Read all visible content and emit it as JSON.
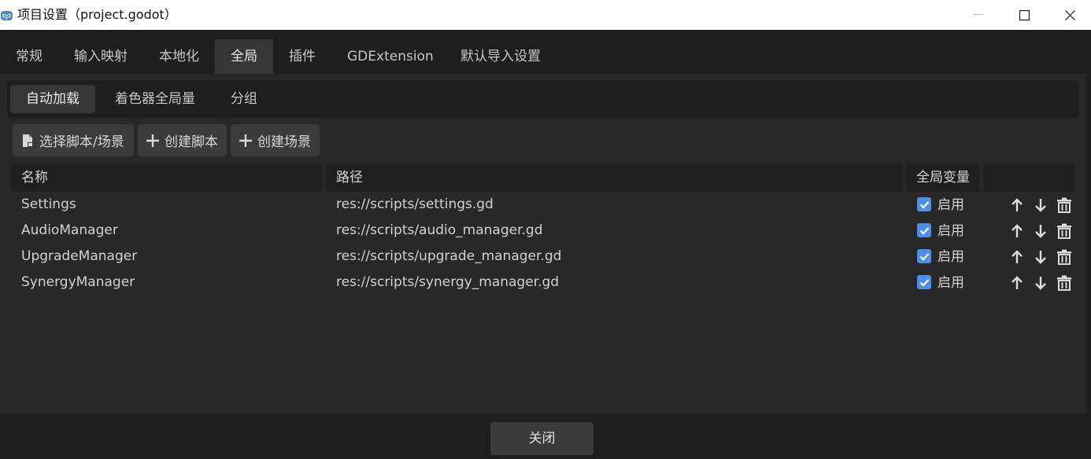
{
  "window": {
    "title": "项目设置（project.godot）",
    "app_icon": "godot-icon",
    "minimize_icon": "minimize-icon",
    "maximize_icon": "maximize-icon",
    "close_icon": "close-icon"
  },
  "tabs": [
    {
      "label": "常规"
    },
    {
      "label": "输入映射"
    },
    {
      "label": "本地化"
    },
    {
      "label": "全局",
      "active": true
    },
    {
      "label": "插件"
    },
    {
      "label": "GDExtension"
    },
    {
      "label": "默认导入设置"
    }
  ],
  "subtabs": [
    {
      "label": "自动加载",
      "active": true
    },
    {
      "label": "着色器全局量"
    },
    {
      "label": "分组"
    }
  ],
  "actions": {
    "select_label": "选择脚本/场景",
    "create_script_label": "创建脚本",
    "create_scene_label": "创建场景"
  },
  "table": {
    "headers": [
      "名称",
      "路径",
      "全局变量",
      ""
    ],
    "rows": [
      {
        "name": "Settings",
        "path": "res://scripts/settings.gd",
        "enabled_label": "启用",
        "enabled": true
      },
      {
        "name": "AudioManager",
        "path": "res://scripts/audio_manager.gd",
        "enabled_label": "启用",
        "enabled": true
      },
      {
        "name": "UpgradeManager",
        "path": "res://scripts/upgrade_manager.gd",
        "enabled_label": "启用",
        "enabled": true
      },
      {
        "name": "SynergyManager",
        "path": "res://scripts/synergy_manager.gd",
        "enabled_label": "启用",
        "enabled": true
      }
    ]
  },
  "footer": {
    "close_label": "关闭"
  },
  "colors": {
    "accent": "#4c8fe8",
    "background": "#1e1e1e",
    "panel": "#282828",
    "button": "#3b3b3b"
  }
}
